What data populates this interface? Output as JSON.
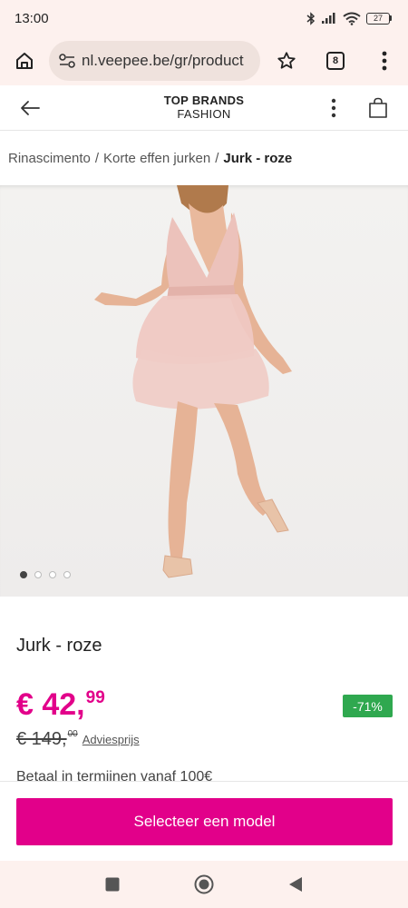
{
  "status_bar": {
    "time": "13:00",
    "battery": "27",
    "icons": [
      "bluetooth-icon",
      "signal-icon",
      "wifi-icon",
      "battery-icon"
    ]
  },
  "browser": {
    "url": "nl.veepee.be/gr/product",
    "tab_count": "8",
    "icons": [
      "home-icon",
      "site-settings-icon",
      "star-icon",
      "tabs-icon",
      "more-vertical-icon"
    ]
  },
  "header": {
    "brand_line1": "TOP BRANDS",
    "brand_line2": "FASHION",
    "icons": [
      "back-arrow-icon",
      "more-vertical-icon",
      "shopping-bag-icon"
    ]
  },
  "breadcrumb": {
    "items": [
      "Rinascimento",
      "Korte effen jurken"
    ],
    "separator": "/",
    "current": "Jurk - roze"
  },
  "gallery": {
    "total_images": 4,
    "active_index": 0
  },
  "product": {
    "title": "Jurk - roze",
    "price_main": "€ 42,",
    "price_cents": "99",
    "old_price_main": "€ 149,",
    "old_price_cents": "00",
    "retail_label": "Adviesprijs",
    "discount": "-71%",
    "installments": "Betaal in termijnen vanaf 100€"
  },
  "cta": {
    "label": "Selecteer een model"
  },
  "colors": {
    "accent": "#e2008a",
    "discount_green": "#2fa84f",
    "chrome_bg": "#fdf1ee"
  }
}
